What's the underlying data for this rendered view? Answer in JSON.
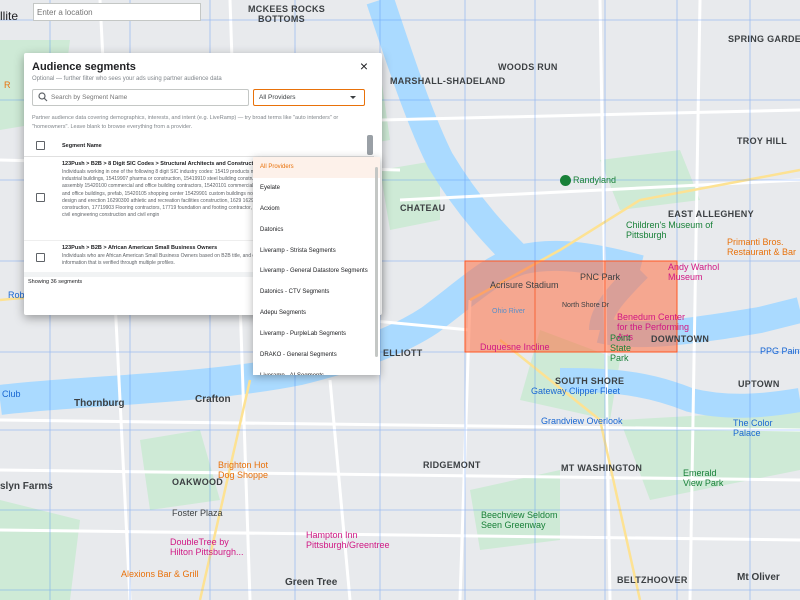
{
  "map": {
    "view_label": "llite",
    "location_input": {
      "value": "",
      "placeholder": "Enter a location"
    },
    "neighborhoods": [
      "MCKEES ROCKS",
      "BOTTOMS",
      "MARSHALL-SHADELAND",
      "WOODS RUN",
      "SPRING GARDEN",
      "TROY HILL",
      "CHATEAU",
      "EAST ALLEGHENY",
      "ELLIOTT",
      "SOUTH SHORE",
      "DOWNTOWN",
      "UPTOWN",
      "Thornburg",
      "Crafton",
      "RIDGEMONT",
      "MT WASHINGTON",
      "OAKWOOD",
      "Green Tree",
      "BELTZHOOVER",
      "Mt Oliver",
      "slyn Farms"
    ],
    "pois": {
      "randyland": "Randyland",
      "childrens_museum": "Children's Museum of Pittsburgh",
      "primanti": "Primanti Bros.",
      "primanti2": "Restaurant & Bar",
      "warhol": "Andy Warhol Museum",
      "pnc": "PNC Park",
      "acrisure": "Acrisure Stadium",
      "north_shore": "North Shore Dr",
      "benedum": "Benedum Center for the Performing Arts",
      "duquesne": "Duquesne Incline",
      "point_state": "Point State Park",
      "ppg": "PPG Paints Arena",
      "gateway": "Gateway Clipper Fleet",
      "grandview": "Grandview Overlook",
      "color_palace": "The Color Palace",
      "brighton": "Brighton Hot Dog Shoppe",
      "foster": "Foster Plaza",
      "hampton": "Hampton Inn Pittsburgh/Greentree",
      "doubletree": "DoubleTree by Hilton Pittsburgh...",
      "alexions": "Alexions Bar & Grill",
      "beechview": "Beechview Seldom Seen Greenway",
      "emerald": "Emerald View Park",
      "robinson": "Rob",
      "ohio_river": "Ohio River",
      "club": "Club",
      "r_left": "R"
    },
    "colors": {
      "land": "#e8eaed",
      "river": "#aadaff",
      "park": "#ceead6",
      "highlight": "#ff7043",
      "grid": "#4285f4"
    }
  },
  "modal": {
    "title": "Audience segments",
    "subtitle": "Optional — further filter who sees your ads using partner audience data",
    "close_icon": "×",
    "search": {
      "value": "",
      "placeholder": "Search by Segment Name"
    },
    "provider": {
      "selected": "All Providers"
    },
    "hint": "Partner audience data covering demographics, interests, and intent (e.g. LiveRamp) — try broad terms like \"auto intenders\" or \"homeowners\". Leave blank to browse everything from a provider.",
    "column_header": "Segment Name",
    "rows": [
      {
        "title": "123Push > B2B > 8 Digit SIC Codes > Structural Architects and Construction",
        "description": "Individuals working in one of the following 8 digit SIC industry codes: 15419 products manufacturing, 15419903 industrial buildings, 15419907 pharma or construction, 15419910 steel building construction, 15419911 auto assembly 15420100 commercial and office building contractors, 15420101 commercial 15420103 commercial and office buildings, prefab, 15420105 shopping center 15429901 custom buildings non-residential, 15429902 design and erection 16290300 athletic and recreation facilities construction, 1629 16290500 industrial plant construction, 17719903 Flooring contractors, 17719 foundation and footing contractor, 871104 Construction and civil engineering construction and civil engin"
      },
      {
        "title": "123Push > B2B > African American Small Business Owners",
        "description": "Individuals who are African American Small Business Owners based on B2B title, and company firmographic information that is verified through multiple profiles."
      }
    ],
    "showing": "Showing 36 segments",
    "dropdown_options": [
      "All Providers",
      "Eyelate",
      "Acxiom",
      "Datonics",
      "Liveramp - Strista Segments",
      "Liveramp - General Datastore Segments",
      "Datonics - CTV Segments",
      "Adepu Segments",
      "Liveramp - PurpleLab Segments",
      "DRAKO - General Segments",
      "Liveramp - AI Segments"
    ]
  }
}
